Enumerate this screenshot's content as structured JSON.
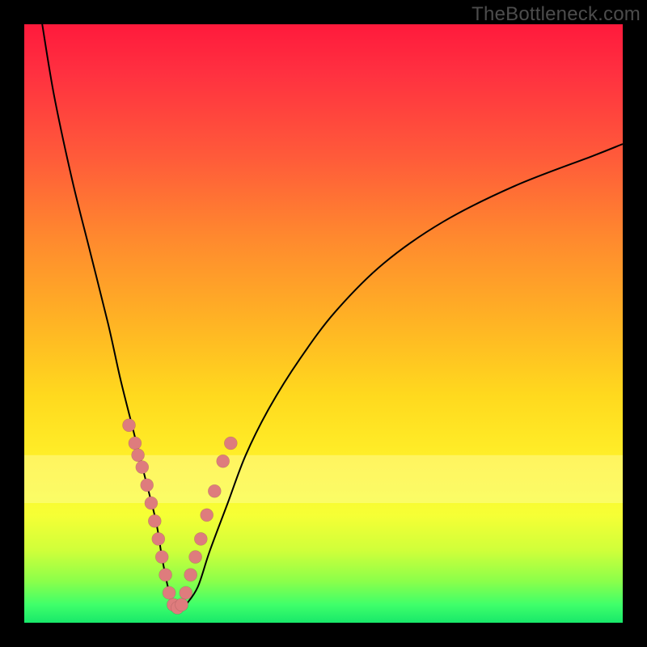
{
  "watermark": "TheBottleneck.com",
  "chart_data": {
    "type": "line",
    "title": "",
    "xlabel": "",
    "ylabel": "",
    "xlim": [
      0,
      100
    ],
    "ylim": [
      0,
      100
    ],
    "grid": false,
    "legend": false,
    "annotations": [],
    "series": [
      {
        "name": "bottleneck-curve",
        "x": [
          3,
          5,
          8,
          11,
          14,
          16,
          18,
          20,
          22,
          23,
          24,
          25,
          26,
          27,
          29,
          31,
          34,
          37,
          41,
          46,
          52,
          60,
          70,
          82,
          95,
          100
        ],
        "values": [
          100,
          88,
          74,
          62,
          50,
          41,
          33,
          25,
          17,
          11,
          6,
          3,
          2,
          3,
          6,
          12,
          20,
          28,
          36,
          44,
          52,
          60,
          67,
          73,
          78,
          80
        ]
      }
    ],
    "highlight_band_y": [
      20,
      28
    ],
    "markers": {
      "name": "data-points",
      "x": [
        17.5,
        18.5,
        19.0,
        19.7,
        20.5,
        21.2,
        21.8,
        22.4,
        23.0,
        23.6,
        24.2,
        24.9,
        25.6,
        26.3,
        27.0,
        27.8,
        28.6,
        29.5,
        30.5,
        31.8,
        33.2,
        34.5
      ],
      "values": [
        33,
        30,
        28,
        26,
        23,
        20,
        17,
        14,
        11,
        8,
        5,
        3,
        2.5,
        3,
        5,
        8,
        11,
        14,
        18,
        22,
        27,
        30
      ]
    }
  },
  "colors": {
    "curve": "#000000",
    "dot": "#de7c7d",
    "frame": "#000000"
  }
}
